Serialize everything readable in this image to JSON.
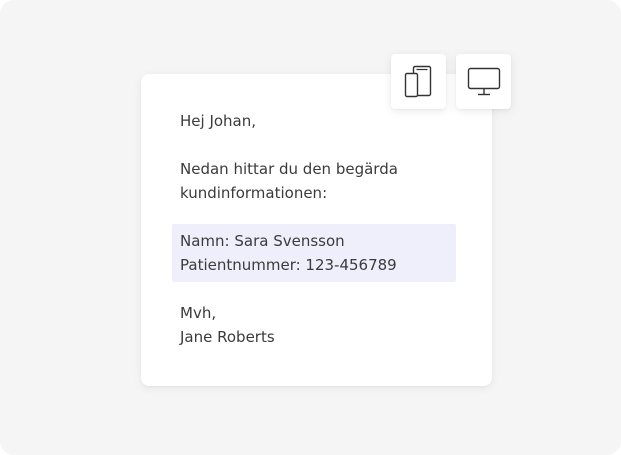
{
  "email": {
    "greeting": "Hej Johan,",
    "intro_line1": "Nedan hittar du den begärda",
    "intro_line2": "kundinformationen:",
    "info_name": "Namn: Sara Svensson",
    "info_patient_number": "Patientnummer: 123-456789",
    "signoff": "Mvh,",
    "signature": "Jane Roberts"
  },
  "toolbar": {
    "mobile_view_icon": "mobile-devices-icon",
    "desktop_view_icon": "desktop-monitor-icon"
  },
  "colors": {
    "background": "#f5f5f6",
    "card": "#ffffff",
    "highlight": "#efeffc",
    "text": "#3b3b3b",
    "icon_stroke": "#333333"
  }
}
